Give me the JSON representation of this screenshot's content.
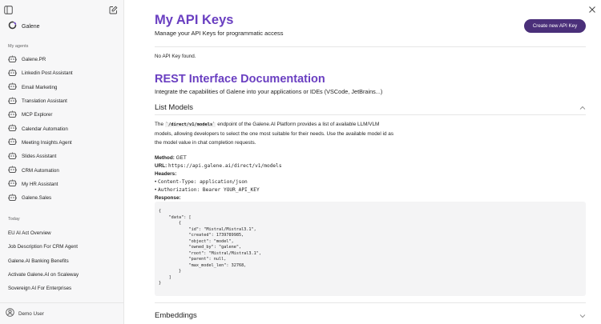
{
  "sidebar": {
    "brand_name": "Galene",
    "agents_heading": "My agents",
    "agents": [
      {
        "label": "Galene.PR"
      },
      {
        "label": "Linkedin Post Assistant"
      },
      {
        "label": "Email Marketing"
      },
      {
        "label": "Translation Assistant"
      },
      {
        "label": "MCP Explorer"
      },
      {
        "label": "Calendar Automation"
      },
      {
        "label": "Meeting Insights Agent"
      },
      {
        "label": "Slides Assistant"
      },
      {
        "label": "CRM Automation"
      },
      {
        "label": "My HR Assistant"
      },
      {
        "label": "Galene.Sales"
      }
    ],
    "today_heading": "Today",
    "chats": [
      {
        "label": "EU AI Act Overview"
      },
      {
        "label": "Job Description For CRM Agent"
      },
      {
        "label": "Galene.AI Banking Benefits"
      },
      {
        "label": "Activate Galene.AI on Scaleway"
      },
      {
        "label": "Sovereign AI For Enterprises"
      }
    ],
    "user_name": "Demo User",
    "icons": {
      "toggle": "sidebar-toggle-icon",
      "compose": "new-chat-icon",
      "agent": "robot-icon",
      "user": "user-avatar-icon"
    }
  },
  "main": {
    "title": "My API Keys",
    "subtitle": "Manage your API Keys for programmatic access",
    "create_button": "Create new API Key",
    "empty_message": "No API Key found.",
    "doc_title": "REST Interface Documentation",
    "doc_subtitle": "Integrate the capabilities of Galene into your applications or IDEs (VSCode, JetBrains...)",
    "section_list_models": {
      "title": "List Models",
      "desc_before": "The ",
      "desc_code": "`/direct/v1/models`",
      "desc_after": " endpoint of the Galene.AI Platform provides a list of available LLM/VLM models, allowing developers to select the one most suitable for their needs. Use the available model id as the model value in chat completion requests.",
      "method_label": "Method:",
      "method_value": " GET",
      "url_label": "URL:",
      "url_value": "https://api.galene.ai/direct/v1/models",
      "headers_label": "Headers:",
      "header_1_key": "Content-Type:",
      "header_1_val": " application/json",
      "header_2_key": "Authorization:",
      "header_2_val": " Bearer YOUR_API_KEY",
      "response_label": "Response:",
      "response_body": "{\n    \"data\": [\n        {\n            \"id\": \"Mistral/Mistral3.1\",\n            \"created\": 1739789985,\n            \"object\": \"model\",\n            \"owned_by\": \"galene\",\n            \"root\": \"Mistral/Mistral3.1\",\n            \"parent\": null,\n            \"max_model_len\": 32768,\n        }\n    ]\n}"
    },
    "section_embeddings": {
      "title": "Embeddings"
    },
    "colors": {
      "accent": "#6a3fc1",
      "button": "#4a2f79"
    }
  }
}
